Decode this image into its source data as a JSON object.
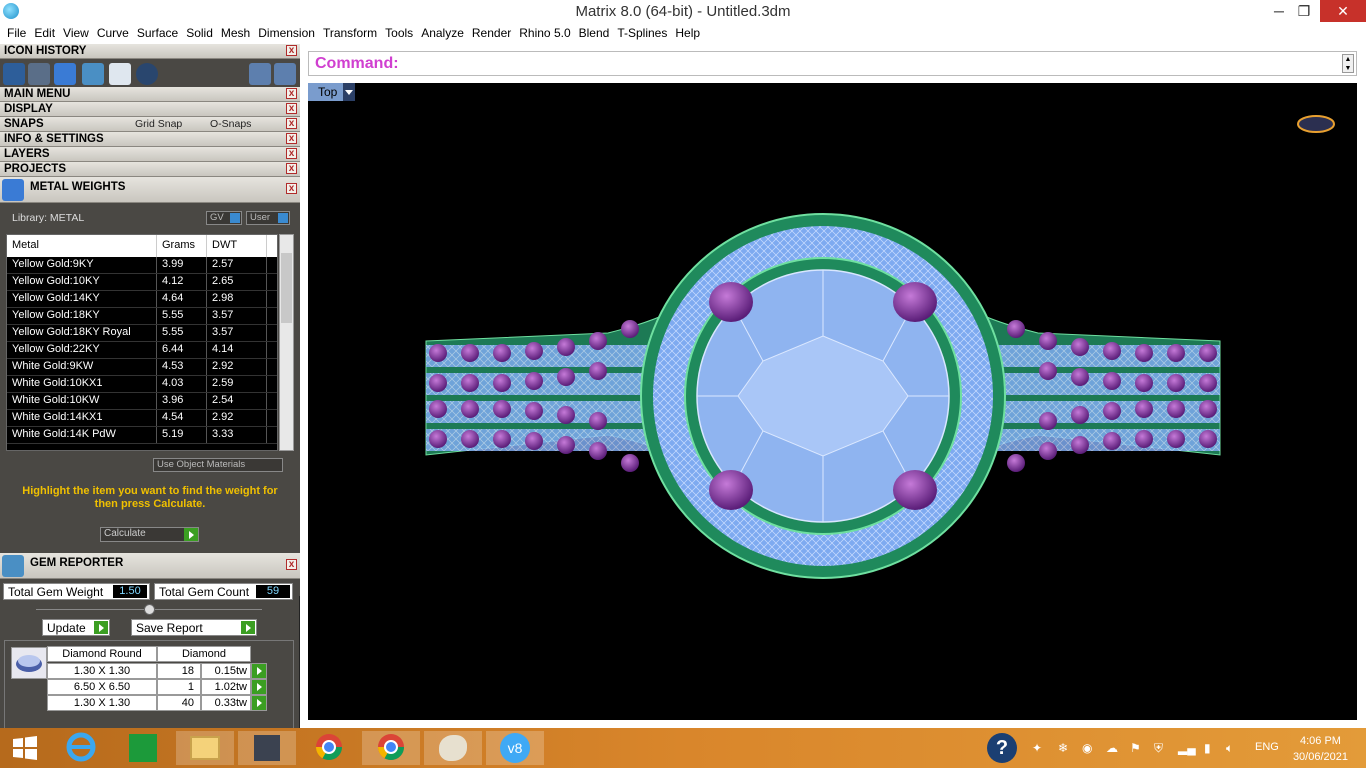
{
  "window": {
    "title": "Matrix 8.0 (64-bit) - Untitled.3dm",
    "minimize_glyph": "─",
    "restore_glyph": "❐",
    "close_glyph": "✕"
  },
  "menubar": [
    "File",
    "Edit",
    "View",
    "Curve",
    "Surface",
    "Solid",
    "Mesh",
    "Dimension",
    "Transform",
    "Tools",
    "Analyze",
    "Render",
    "Rhino 5.0",
    "Blend",
    "T-Splines",
    "Help"
  ],
  "panels": {
    "icon_history": "ICON HISTORY",
    "main_menu": "MAIN MENU",
    "display": "DISPLAY",
    "snaps": "SNAPS",
    "grid_snap": "Grid Snap",
    "o_snaps": "O-Snaps",
    "info_settings": "INFO & SETTINGS",
    "layers": "LAYERS",
    "projects": "PROJECTS",
    "close_glyph": "x"
  },
  "metal_weights": {
    "title": "METAL WEIGHTS",
    "library_label": "Library: METAL",
    "gv_label": "GV",
    "user_label": "User",
    "columns": [
      "Metal",
      "Grams",
      "DWT"
    ],
    "rows": [
      [
        "Yellow Gold:9KY",
        "3.99",
        "2.57"
      ],
      [
        "Yellow Gold:10KY",
        "4.12",
        "2.65"
      ],
      [
        "Yellow Gold:14KY",
        "4.64",
        "2.98"
      ],
      [
        "Yellow Gold:18KY",
        "5.55",
        "3.57"
      ],
      [
        "Yellow Gold:18KY Royal",
        "5.55",
        "3.57"
      ],
      [
        "Yellow Gold:22KY",
        "6.44",
        "4.14"
      ],
      [
        "White Gold:9KW",
        "4.53",
        "2.92"
      ],
      [
        "White Gold:10KX1",
        "4.03",
        "2.59"
      ],
      [
        "White Gold:10KW",
        "3.96",
        "2.54"
      ],
      [
        "White Gold:14KX1",
        "4.54",
        "2.92"
      ],
      [
        "White Gold:14K PdW",
        "5.19",
        "3.33"
      ]
    ],
    "use_object_materials": "Use Object Materials",
    "hint": "Highlight the item you want to find the weight for then press Calculate.",
    "calculate": "Calculate"
  },
  "gem_reporter": {
    "title": "GEM REPORTER",
    "total_weight_label": "Total Gem Weight",
    "total_weight_value": "1.50",
    "total_count_label": "Total Gem Count",
    "total_count_value": "59",
    "update": "Update",
    "save_report": "Save Report",
    "col_shape": "Diamond Round",
    "col_type": "Diamond",
    "rows": [
      {
        "size": "1.30 X 1.30",
        "qty": "18",
        "tw": "0.15tw"
      },
      {
        "size": "6.50 X 6.50",
        "qty": "1",
        "tw": "1.02tw"
      },
      {
        "size": "1.30 X 1.30",
        "qty": "40",
        "tw": "0.33tw"
      }
    ]
  },
  "command": {
    "label": "Command:"
  },
  "viewport": {
    "name": "Top"
  },
  "taskbar": {
    "lang": "ENG",
    "time": "4:06 PM",
    "date": "30/06/2021"
  },
  "colors": {
    "panel_bg": "#4a4844",
    "accent_magenta": "#d03fd0",
    "hint_yellow": "#f0c000",
    "gem_blue": "#8fb4f0",
    "band_green": "#1f8a5c",
    "amethyst": "#8a3aa8"
  }
}
